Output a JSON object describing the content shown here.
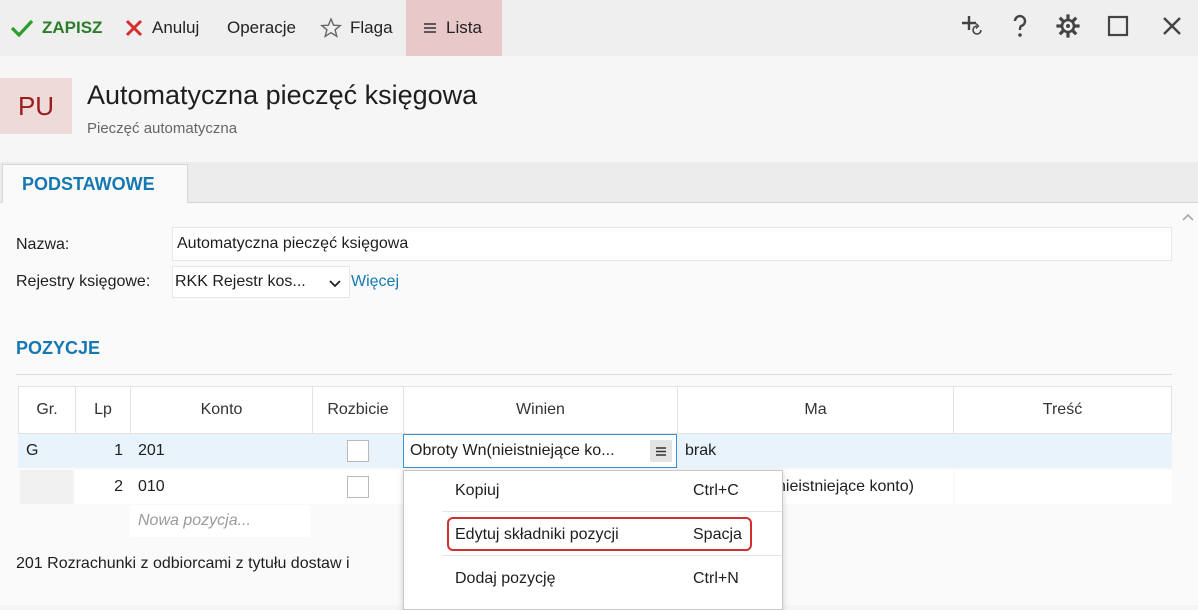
{
  "toolbar": {
    "save": "ZAPISZ",
    "cancel": "Anuluj",
    "operations": "Operacje",
    "flag": "Flaga",
    "list": "Lista"
  },
  "header": {
    "badge": "PU",
    "title": "Automatyczna pieczęć księgowa",
    "subtitle": "Pieczęć automatyczna"
  },
  "tabs": [
    {
      "label": "PODSTAWOWE",
      "active": true
    }
  ],
  "form": {
    "name_label": "Nazwa:",
    "name_value": "Automatyczna pieczęć księgowa",
    "registers_label": "Rejestry księgowe:",
    "registers_value": "RKK  Rejestr kos...",
    "more_link": "Więcej"
  },
  "positions": {
    "section_title": "POZYCJE",
    "columns": [
      "Gr.",
      "Lp",
      "Konto",
      "Rozbicie",
      "Winien",
      "Ma",
      "Treść"
    ],
    "rows": [
      {
        "gr": "G",
        "lp": "1",
        "konto": "201",
        "winien": "Obroty Wn(nieistniejące ko...",
        "ma": "brak",
        "tresc": ""
      },
      {
        "gr": "",
        "lp": "2",
        "konto": "010",
        "winien": "",
        "ma": "nieistniejące konto)",
        "tresc": ""
      }
    ],
    "new_placeholder": "Nowa pozycja..."
  },
  "status_text": "201   Rozrachunki z odbiorcami z tytułu dostaw i",
  "context_menu": {
    "items": [
      {
        "label": "Kopiuj",
        "shortcut": "Ctrl+C"
      },
      {
        "label": "Edytuj składniki pozycji",
        "shortcut": "Spacja"
      },
      {
        "label": "Dodaj pozycję",
        "shortcut": "Ctrl+N"
      }
    ]
  },
  "colors": {
    "accent": "#1678b3",
    "save_green": "#2a7d2a",
    "cancel_red": "#d32f2f",
    "badge_bg": "#efdada",
    "badge_text": "#9b1b1b",
    "list_bg": "#e8c8c8",
    "highlight": "#d32f2f"
  },
  "icons": {
    "save": "checkmark-icon",
    "cancel": "x-icon",
    "flag": "star-icon",
    "list": "hamburger-icon",
    "add": "add-refresh-icon",
    "help": "question-icon",
    "settings": "gear-icon",
    "maximize": "square-icon",
    "close": "close-icon"
  }
}
